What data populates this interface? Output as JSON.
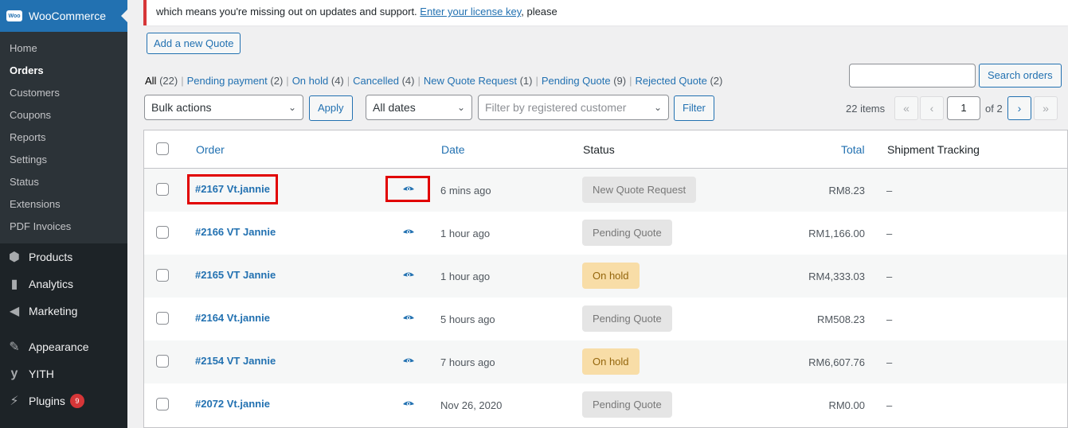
{
  "sidebar": {
    "header": {
      "label": "WooCommerce",
      "icon": "woo-icon",
      "icon_text": "Woo"
    },
    "submenu": [
      {
        "label": "Home",
        "active": false
      },
      {
        "label": "Orders",
        "active": true
      },
      {
        "label": "Customers",
        "active": false
      },
      {
        "label": "Coupons",
        "active": false
      },
      {
        "label": "Reports",
        "active": false
      },
      {
        "label": "Settings",
        "active": false
      },
      {
        "label": "Status",
        "active": false
      },
      {
        "label": "Extensions",
        "active": false
      },
      {
        "label": "PDF Invoices",
        "active": false
      }
    ],
    "menu": [
      {
        "label": "Products",
        "icon": "cube-icon",
        "glyph": "⬢"
      },
      {
        "label": "Analytics",
        "icon": "bar-chart-icon",
        "glyph": "▮"
      },
      {
        "label": "Marketing",
        "icon": "megaphone-icon",
        "glyph": "◀"
      },
      {
        "label": "Appearance",
        "icon": "paintbrush-icon",
        "glyph": "✎"
      },
      {
        "label": "YITH",
        "icon": "yith-icon",
        "glyph": "y"
      },
      {
        "label": "Plugins",
        "icon": "plugin-icon",
        "glyph": "⚡",
        "badge": "9"
      }
    ]
  },
  "notice": {
    "text": "which means you're missing out on updates and support. ",
    "link": "Enter your license key",
    "suffix": ", please"
  },
  "add_quote_label": "Add a new Quote",
  "filters": {
    "all": {
      "label": "All",
      "count": "(22)"
    },
    "items": [
      {
        "label": "Pending payment",
        "count": "(2)"
      },
      {
        "label": "On hold",
        "count": "(4)"
      },
      {
        "label": "Cancelled",
        "count": "(4)"
      },
      {
        "label": "New Quote Request",
        "count": "(1)"
      },
      {
        "label": "Pending Quote",
        "count": "(9)"
      },
      {
        "label": "Rejected Quote",
        "count": "(2)"
      }
    ]
  },
  "search": {
    "value": "",
    "button": "Search orders"
  },
  "bulk_actions": {
    "selected": "Bulk actions",
    "apply": "Apply"
  },
  "date_filter": {
    "selected": "All dates"
  },
  "customer_filter": {
    "placeholder": "Filter by registered customer",
    "button": "Filter"
  },
  "pagination": {
    "items": "22 items",
    "first": "«",
    "prev": "‹",
    "current": "1",
    "of": "of 2",
    "next": "›",
    "last": "»"
  },
  "table": {
    "headers": {
      "order": "Order",
      "date": "Date",
      "status": "Status",
      "total": "Total",
      "tracking": "Shipment Tracking"
    },
    "rows": [
      {
        "order": "#2167 Vt.jannie",
        "date": "6 mins ago",
        "status": "New Quote Request",
        "status_type": "gray",
        "total": "RM8.23",
        "tracking": "–"
      },
      {
        "order": "#2166 VT Jannie",
        "date": "1 hour ago",
        "status": "Pending Quote",
        "status_type": "gray",
        "total": "RM1,166.00",
        "tracking": "–"
      },
      {
        "order": "#2165 VT Jannie",
        "date": "1 hour ago",
        "status": "On hold",
        "status_type": "hold",
        "total": "RM4,333.03",
        "tracking": "–"
      },
      {
        "order": "#2164 Vt.jannie",
        "date": "5 hours ago",
        "status": "Pending Quote",
        "status_type": "gray",
        "total": "RM508.23",
        "tracking": "–"
      },
      {
        "order": "#2154 VT Jannie",
        "date": "7 hours ago",
        "status": "On hold",
        "status_type": "hold",
        "total": "RM6,607.76",
        "tracking": "–"
      },
      {
        "order": "#2072 Vt.jannie",
        "date": "Nov 26, 2020",
        "status": "Pending Quote",
        "status_type": "gray",
        "total": "RM0.00",
        "tracking": "–"
      }
    ]
  },
  "colors": {
    "accent": "#2271b1",
    "highlight": "#e10000",
    "hold_bg": "#f8dda7",
    "gray_bg": "#e5e5e5"
  }
}
